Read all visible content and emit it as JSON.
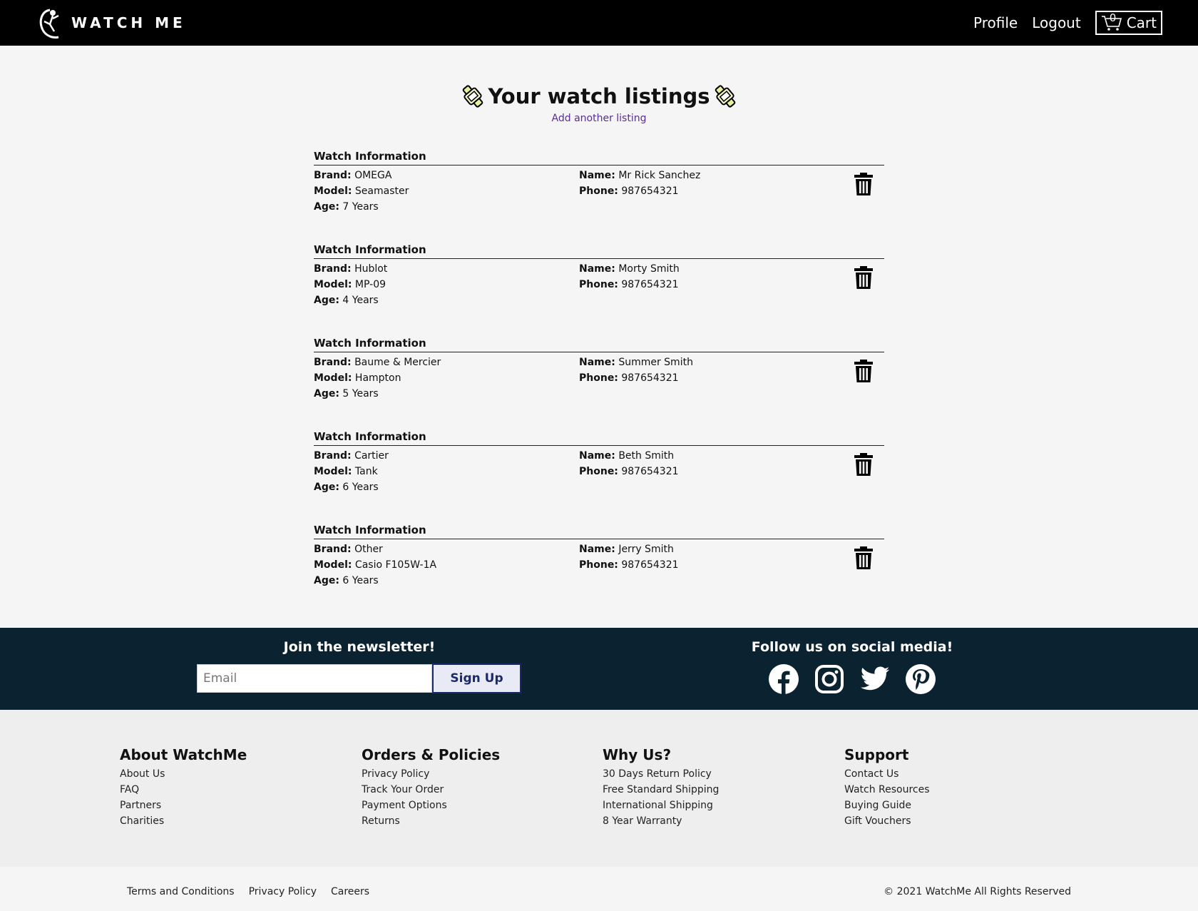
{
  "header": {
    "brand_name": "WATCH ME",
    "nav": {
      "profile": "Profile",
      "logout": "Logout",
      "cart_label": "Cart",
      "cart_count": "0"
    }
  },
  "main": {
    "title": "Your watch listings",
    "add_link": "Add another listing",
    "listing_section_title": "Watch Information",
    "field_labels": {
      "brand": "Brand:",
      "model": "Model:",
      "age": "Age:",
      "name": "Name:",
      "phone": "Phone:"
    },
    "listings": [
      {
        "brand": "OMEGA",
        "model": "Seamaster",
        "age": "7 Years",
        "name": "Mr Rick Sanchez",
        "phone": "987654321"
      },
      {
        "brand": "Hublot",
        "model": "MP-09",
        "age": "4 Years",
        "name": "Morty Smith",
        "phone": "987654321"
      },
      {
        "brand": "Baume & Mercier",
        "model": "Hampton",
        "age": "5 Years",
        "name": "Summer Smith",
        "phone": "987654321"
      },
      {
        "brand": "Cartier",
        "model": "Tank",
        "age": "6 Years",
        "name": "Beth Smith",
        "phone": "987654321"
      },
      {
        "brand": "Other",
        "model": "Casio F105W-1A",
        "age": "6 Years",
        "name": "Jerry Smith",
        "phone": "987654321"
      }
    ]
  },
  "newsletter": {
    "title": "Join the newsletter!",
    "email_placeholder": "Email",
    "signup_label": "Sign Up"
  },
  "social": {
    "title": "Follow us on social media!",
    "icons": [
      "facebook-icon",
      "instagram-icon",
      "twitter-icon",
      "pinterest-icon"
    ]
  },
  "footer": {
    "columns": [
      {
        "title": "About WatchMe",
        "links": [
          "About Us",
          "FAQ",
          "Partners",
          "Charities"
        ]
      },
      {
        "title": "Orders & Policies",
        "links": [
          "Privacy Policy",
          "Track Your Order",
          "Payment Options",
          "Returns"
        ]
      },
      {
        "title": "Why Us?",
        "links": [
          "30 Days Return Policy",
          "Free Standard Shipping",
          "International Shipping",
          "8 Year Warranty"
        ]
      },
      {
        "title": "Support",
        "links": [
          "Contact Us",
          "Watch Resources",
          "Buying Guide",
          "Gift Vouchers"
        ]
      }
    ],
    "bottom_links": [
      "Terms and Conditions",
      "Privacy Policy",
      "Careers"
    ],
    "copyright": "© 2021 WatchMe All Rights Reserved"
  },
  "colors": {
    "header_bg": "#000000",
    "newsletter_bg": "#0b2230",
    "footer_bg": "#eeeeee",
    "link_purple": "#5a2d91",
    "signup_border": "#1b2a6b"
  }
}
